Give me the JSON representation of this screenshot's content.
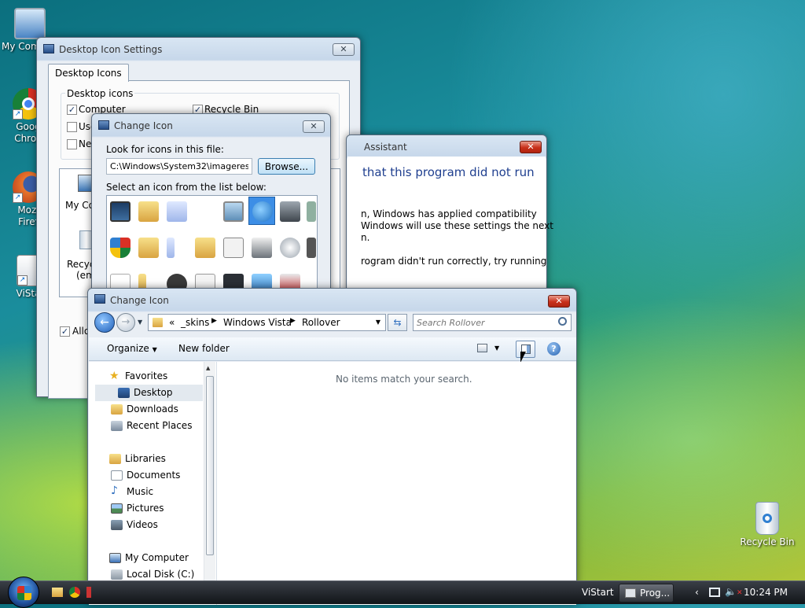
{
  "desktop": {
    "icons": [
      {
        "label": "My Com",
        "icon": "computer-icon"
      },
      {
        "label": "Goog",
        "label2": "Chron",
        "icon": "chrome-icon"
      },
      {
        "label": "Mozi",
        "label2": "Firef",
        "icon": "firefox-icon"
      },
      {
        "label": "ViSta",
        "icon": "document-icon"
      },
      {
        "label": "Recycle Bin",
        "icon": "recycle-bin-icon"
      }
    ]
  },
  "desktop_icon_settings": {
    "title": "Desktop Icon Settings",
    "close": "✕",
    "tab": "Desktop Icons",
    "group_title": "Desktop icons",
    "checkboxes": [
      {
        "label": "Computer",
        "checked": true
      },
      {
        "label": "Recycle Bin",
        "checked": true
      },
      {
        "label": "Use",
        "checked": false
      },
      {
        "label": "Net",
        "checked": false
      }
    ],
    "preview_items": [
      {
        "label": "My Co"
      },
      {
        "label": "Recyc",
        "label2": "(emp"
      }
    ],
    "allow_label": "Allov",
    "allow_checked": true
  },
  "change_icon_dialog": {
    "title": "Change Icon",
    "close": "✕",
    "look_label": "Look for icons in this file:",
    "file_value": "C:\\Windows\\System32\\imageres.dll",
    "browse": "Browse...",
    "select_label": "Select an icon from the list below:"
  },
  "assistant": {
    "title": "Assistant",
    "close": "✕",
    "heading": "that this program did not run",
    "line1": "n, Windows has applied compatibility",
    "line2": " Windows will use these settings the next",
    "line3": "n.",
    "line4": "rogram didn't run correctly, try running"
  },
  "explorer": {
    "title": "Change Icon",
    "close": "✕",
    "breadcrumb": [
      "«",
      "_skins",
      "Windows Vista",
      "Rollover"
    ],
    "search_placeholder": "Search Rollover",
    "organize": "Organize",
    "new_folder": "New folder",
    "empty_message": "No items match your search.",
    "nav": [
      {
        "label": "Favorites",
        "icon": "star-icon",
        "color": "#e8b020"
      },
      {
        "label": "Desktop",
        "icon": "desktop-icon",
        "color": "#3a6fb5",
        "selected": true
      },
      {
        "label": "Downloads",
        "icon": "downloads-icon",
        "color": "#d9a441"
      },
      {
        "label": "Recent Places",
        "icon": "recent-places-icon",
        "color": "#7a8a9c"
      },
      {
        "label": "Libraries",
        "icon": "libraries-icon",
        "color": "#d9a441"
      },
      {
        "label": "Documents",
        "icon": "documents-icon",
        "color": "#c9d3de"
      },
      {
        "label": "Music",
        "icon": "music-icon",
        "color": "#2f6fbf"
      },
      {
        "label": "Pictures",
        "icon": "pictures-icon",
        "color": "#4d8a54"
      },
      {
        "label": "Videos",
        "icon": "videos-icon",
        "color": "#4b5968"
      },
      {
        "label": "My Computer",
        "icon": "computer-icon",
        "color": "#3a6fb5"
      },
      {
        "label": "Local Disk (C:)",
        "icon": "local-disk-icon",
        "color": "#8c98a4"
      }
    ]
  },
  "taskbar": {
    "tasks": [
      {
        "label": "ViStart"
      },
      {
        "label": "Prog..."
      }
    ],
    "clock": "10:24 PM"
  }
}
